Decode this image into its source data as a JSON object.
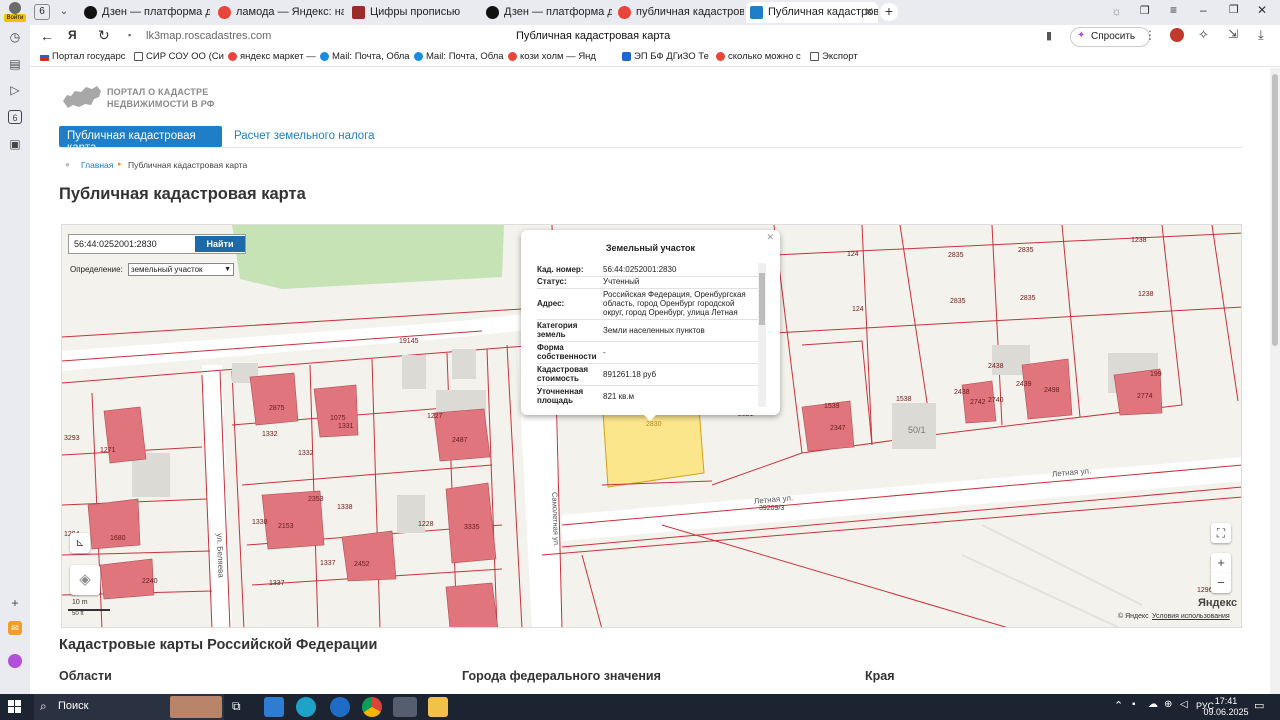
{
  "browser": {
    "tab_count_badge": "6",
    "tabs": [
      {
        "label": "Дзен — платформа для п"
      },
      {
        "label": "ламода — Яндекс: нашё"
      },
      {
        "label": "Цифры прописью"
      },
      {
        "label": "Дзен — платформа для п"
      },
      {
        "label": "публичная кадастровая"
      },
      {
        "label": "Публичная кадастровая"
      }
    ],
    "url": "lk3map.roscadastres.com",
    "page_title": "Публичная кадастровая карта",
    "ask_label": "Спросить",
    "profile_label": "Войти",
    "bookmarks": [
      {
        "label": "Портал государс"
      },
      {
        "label": "СИР СОУ ОО (Си"
      },
      {
        "label": "яндекс маркет —"
      },
      {
        "label": "Mail: Почта, Обла"
      },
      {
        "label": "Mail: Почта, Обла"
      },
      {
        "label": "кози холм — Янд"
      },
      {
        "label": "ЭП БФ ДГиЗО Те"
      },
      {
        "label": "сколько можно с"
      },
      {
        "label": "Экспорт"
      }
    ]
  },
  "site": {
    "logo_line1": "ПОРТАЛ О КАДАСТРЕ",
    "logo_line2": "НЕДВИЖИМОСТИ В РФ",
    "nav": [
      {
        "label": "Публичная кадастровая карта"
      },
      {
        "label": "Расчет земельного налога"
      }
    ],
    "breadcrumb_home": "Главная",
    "breadcrumb_current": "Публичная кадастровая карта",
    "page_heading": "Публичная кадастровая карта",
    "section_heading": "Кадастровые карты Российской Федерации",
    "columns": [
      {
        "label": "Области"
      },
      {
        "label": "Города федерального значения"
      },
      {
        "label": "Края"
      }
    ]
  },
  "map": {
    "search_value": "56:44:0252001:2830",
    "search_button": "Найти",
    "definition_label": "Определение:",
    "definition_value": "земельный участок",
    "scale_10m": "10 m",
    "scale_50ft": "50 ft",
    "copyright": "© Яндекс",
    "terms": "Условия использования",
    "brand": "Яндекс",
    "street_letnyaya": "Летная ул.",
    "street_letnyaya2": "Летная ул.",
    "street_belyaeva": "ул. Беляева",
    "street_samoletnaya": "Самолетная ул.",
    "parcel_labels": [
      "19145",
      "2875",
      "1332",
      "1075",
      "1331",
      "1227",
      "2487",
      "3293",
      "1271",
      "1332",
      "2353",
      "1338",
      "2153",
      "1338",
      "1228",
      "3335",
      "1680",
      "1337",
      "2452",
      "2240",
      "1337",
      "1294",
      "124",
      "124",
      "2835",
      "2835",
      "2835",
      "2835",
      "1238",
      "1238",
      "1539",
      "1538",
      "2347",
      "50/1",
      "2438",
      "2438",
      "2742",
      "2740",
      "2439",
      "2498",
      "199",
      "2774",
      "39209/3",
      "1296",
      "2830",
      "2821"
    ]
  },
  "popup": {
    "title": "Земельный участок",
    "rows": [
      {
        "key": "Кад. номер:",
        "value": "56:44:0252001:2830"
      },
      {
        "key": "Статус:",
        "value": "Учтенный"
      },
      {
        "key": "Адрес:",
        "value": "Российская Федерация, Оренбургская область, город Оренбург городской округ, город Оренбург, улица Летная"
      },
      {
        "key": "Категория земель",
        "value": "Земли населенных пунктов"
      },
      {
        "key": "Форма собственности",
        "value": "-"
      },
      {
        "key": "Кадастровая стоимость",
        "value": "891261.18 руб"
      },
      {
        "key": "Уточненная площадь",
        "value": "821 кв.м"
      }
    ]
  },
  "taskbar": {
    "search_label": "Поиск",
    "lang": "РУС",
    "time": "17:41",
    "date": "09.06.2025"
  },
  "colors": {
    "accent": "#1e7ec8",
    "parcel_line": "#c8323c",
    "building": "#e0757d",
    "selected_parcel": "#fbe68c",
    "taskbar": "#1d2431"
  }
}
